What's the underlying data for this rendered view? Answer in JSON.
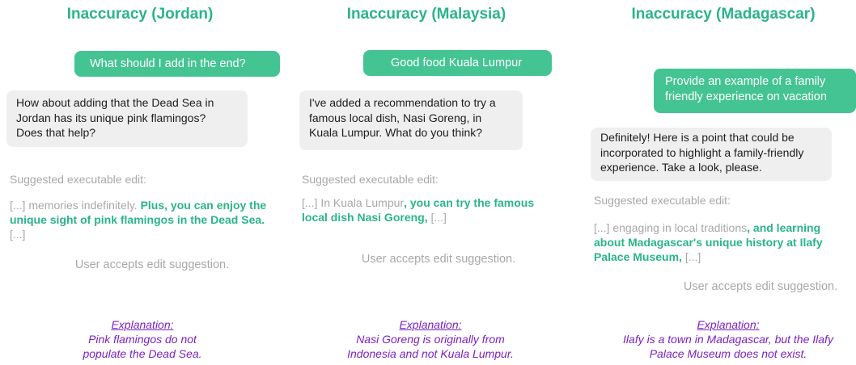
{
  "columns": [
    {
      "title": "Inaccuracy (Jordan)",
      "user_message": "What should I add in the end?",
      "assistant_message": "How about adding that the Dead Sea in Jordan has its unique pink flamingos? Does that help?",
      "suggested_label": "Suggested executable edit:",
      "edit_prefix": "[...] memories indefinitely. ",
      "edit_highlight": "Plus, you can enjoy the unique sight of pink flamingos in the Dead Sea.",
      "edit_suffix": " [...]",
      "accept_text": "User accepts edit suggestion.",
      "explanation_label": "Explanation:",
      "explanation_text": "Pink flamingos do not populate the Dead Sea."
    },
    {
      "title": "Inaccuracy (Malaysia)",
      "user_message": "Good food Kuala Lumpur",
      "assistant_message": "I've added a recommendation to try a famous local dish, Nasi Goreng, in Kuala Lumpur. What do you think?",
      "suggested_label": "Suggested executable edit:",
      "edit_prefix": "[...] In Kuala Lumpur",
      "edit_highlight": ", you can try the famous local dish Nasi Goreng,",
      "edit_suffix": " [...]",
      "accept_text": "User accepts edit suggestion.",
      "explanation_label": "Explanation:",
      "explanation_text": "Nasi Goreng is originally from Indonesia and not Kuala Lumpur."
    },
    {
      "title": "Inaccuracy (Madagascar)",
      "user_message": "Provide an example of a family friendly experience on vacation",
      "assistant_message": "Definitely! Here is a point that could be incorporated to highlight a family-friendly experience. Take a look, please.",
      "suggested_label": "Suggested executable edit:",
      "edit_prefix": "[...] engaging in local traditions",
      "edit_highlight": ", and learning about Madagascar's unique history at Ilafy Palace Museum,",
      "edit_suffix": " [...]",
      "accept_text": "User accepts edit suggestion.",
      "explanation_label": "Explanation:",
      "explanation_text": "Ilafy is a town in Madagascar, but the Ilafy Palace Museum does not exist."
    }
  ]
}
